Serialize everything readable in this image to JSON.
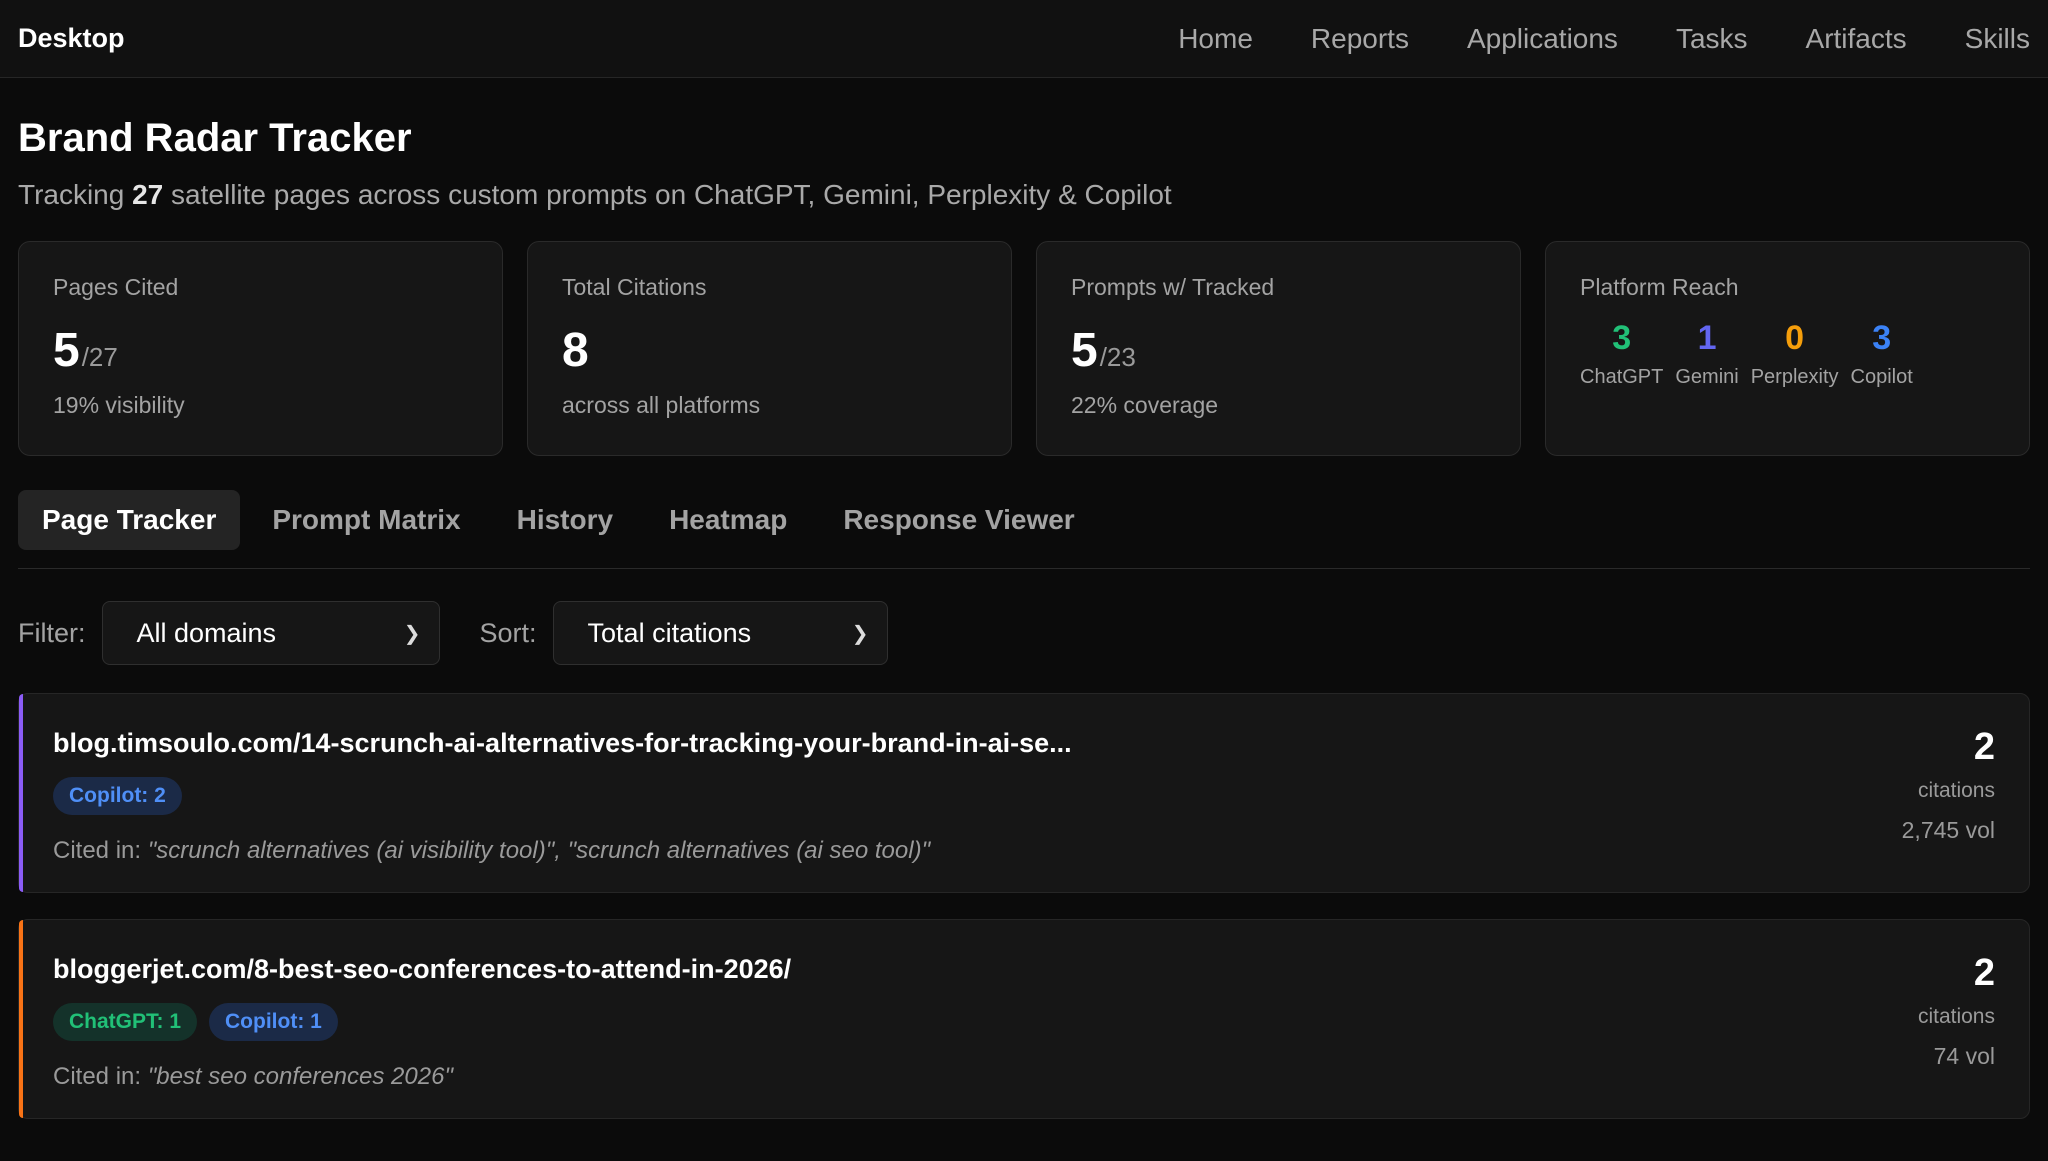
{
  "app": {
    "title": "Desktop"
  },
  "nav": [
    "Home",
    "Reports",
    "Applications",
    "Tasks",
    "Artifacts",
    "Skills"
  ],
  "page": {
    "title": "Brand Radar Tracker",
    "subtitle_pre": "Tracking ",
    "subtitle_count": "27",
    "subtitle_post": " satellite pages across custom prompts on ChatGPT, Gemini, Perplexity & Copilot"
  },
  "stats": {
    "pages_cited": {
      "label": "Pages Cited",
      "value": "5",
      "denominator": "/27",
      "sub": "19% visibility"
    },
    "total_citations": {
      "label": "Total Citations",
      "value": "8",
      "sub": "across all platforms"
    },
    "prompts_tracked": {
      "label": "Prompts w/ Tracked",
      "value": "5",
      "denominator": "/23",
      "sub": "22% coverage"
    },
    "platform_reach": {
      "label": "Platform Reach",
      "items": [
        {
          "value": "3",
          "label": "ChatGPT",
          "color": "#21c077"
        },
        {
          "value": "1",
          "label": "Gemini",
          "color": "#6366f1"
        },
        {
          "value": "0",
          "label": "Perplexity",
          "color": "#f59e0b"
        },
        {
          "value": "3",
          "label": "Copilot",
          "color": "#3b82f6"
        }
      ]
    }
  },
  "tabs": [
    "Page Tracker",
    "Prompt Matrix",
    "History",
    "Heatmap",
    "Response Viewer"
  ],
  "filters": {
    "filter_label": "Filter:",
    "filter_value": "All domains",
    "sort_label": "Sort:",
    "sort_value": "Total citations"
  },
  "results": [
    {
      "url": "blog.timsoulo.com/14-scrunch-ai-alternatives-for-tracking-your-brand-in-ai-se...",
      "accent": "#8b5cf6",
      "badges": [
        {
          "text": "Copilot: 2",
          "type": "copilot"
        }
      ],
      "cited_prefix": "Cited in: ",
      "cited_in": "\"scrunch alternatives (ai visibility tool)\", \"scrunch alternatives (ai seo tool)\"",
      "count": "2",
      "count_label": "citations",
      "volume": "2,745 vol"
    },
    {
      "url": "bloggerjet.com/8-best-seo-conferences-to-attend-in-2026/",
      "accent": "#f97316",
      "badges": [
        {
          "text": "ChatGPT: 1",
          "type": "chatgpt"
        },
        {
          "text": "Copilot: 1",
          "type": "copilot"
        }
      ],
      "cited_prefix": "Cited in: ",
      "cited_in": "\"best seo conferences 2026\"",
      "count": "2",
      "count_label": "citations",
      "volume": "74 vol"
    }
  ]
}
